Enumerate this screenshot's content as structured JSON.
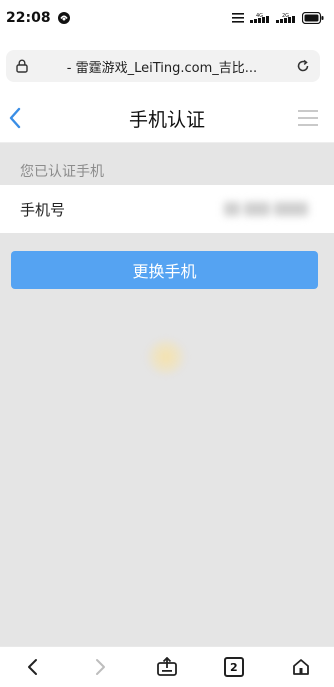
{
  "status_bar": {
    "time": "22:08",
    "signal_labels": [
      "4G",
      "2G"
    ]
  },
  "browser": {
    "url_title": "- 雷霆游戏_LeiTing.com_吉比..."
  },
  "header": {
    "title": "手机认证"
  },
  "main": {
    "section_label": "您已认证手机",
    "phone_label": "手机号",
    "change_button": "更换手机"
  },
  "bottom_nav": {
    "tab_count": "2"
  },
  "colors": {
    "accent": "#55a3f2",
    "background": "#e5e5e5"
  }
}
